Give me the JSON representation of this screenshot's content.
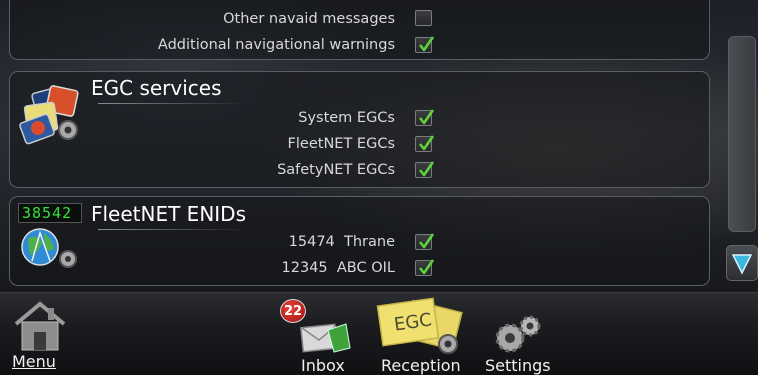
{
  "panel_top": {
    "rows": [
      {
        "label": "Other navaid messages",
        "checked": false
      },
      {
        "label": "Additional navigational warnings",
        "checked": true
      }
    ]
  },
  "egc": {
    "title": "EGC services",
    "rows": [
      {
        "label": "System EGCs",
        "checked": true
      },
      {
        "label": "FleetNET EGCs",
        "checked": true
      },
      {
        "label": "SafetyNET EGCs",
        "checked": true
      }
    ],
    "icon": "egc-services-icon"
  },
  "fleetnet": {
    "title": "FleetNET ENIDs",
    "counter": "38542",
    "rows": [
      {
        "label": "15474  Thrane",
        "checked": true
      },
      {
        "label": "12345  ABC OIL",
        "checked": true
      }
    ]
  },
  "nav": {
    "menu": "Menu",
    "inbox": "Inbox",
    "inbox_count": "22",
    "reception": "Reception",
    "reception_icon_text": "EGC",
    "settings": "Settings"
  },
  "colors": {
    "check": "#5fd13a",
    "badge": "#c8201a"
  }
}
